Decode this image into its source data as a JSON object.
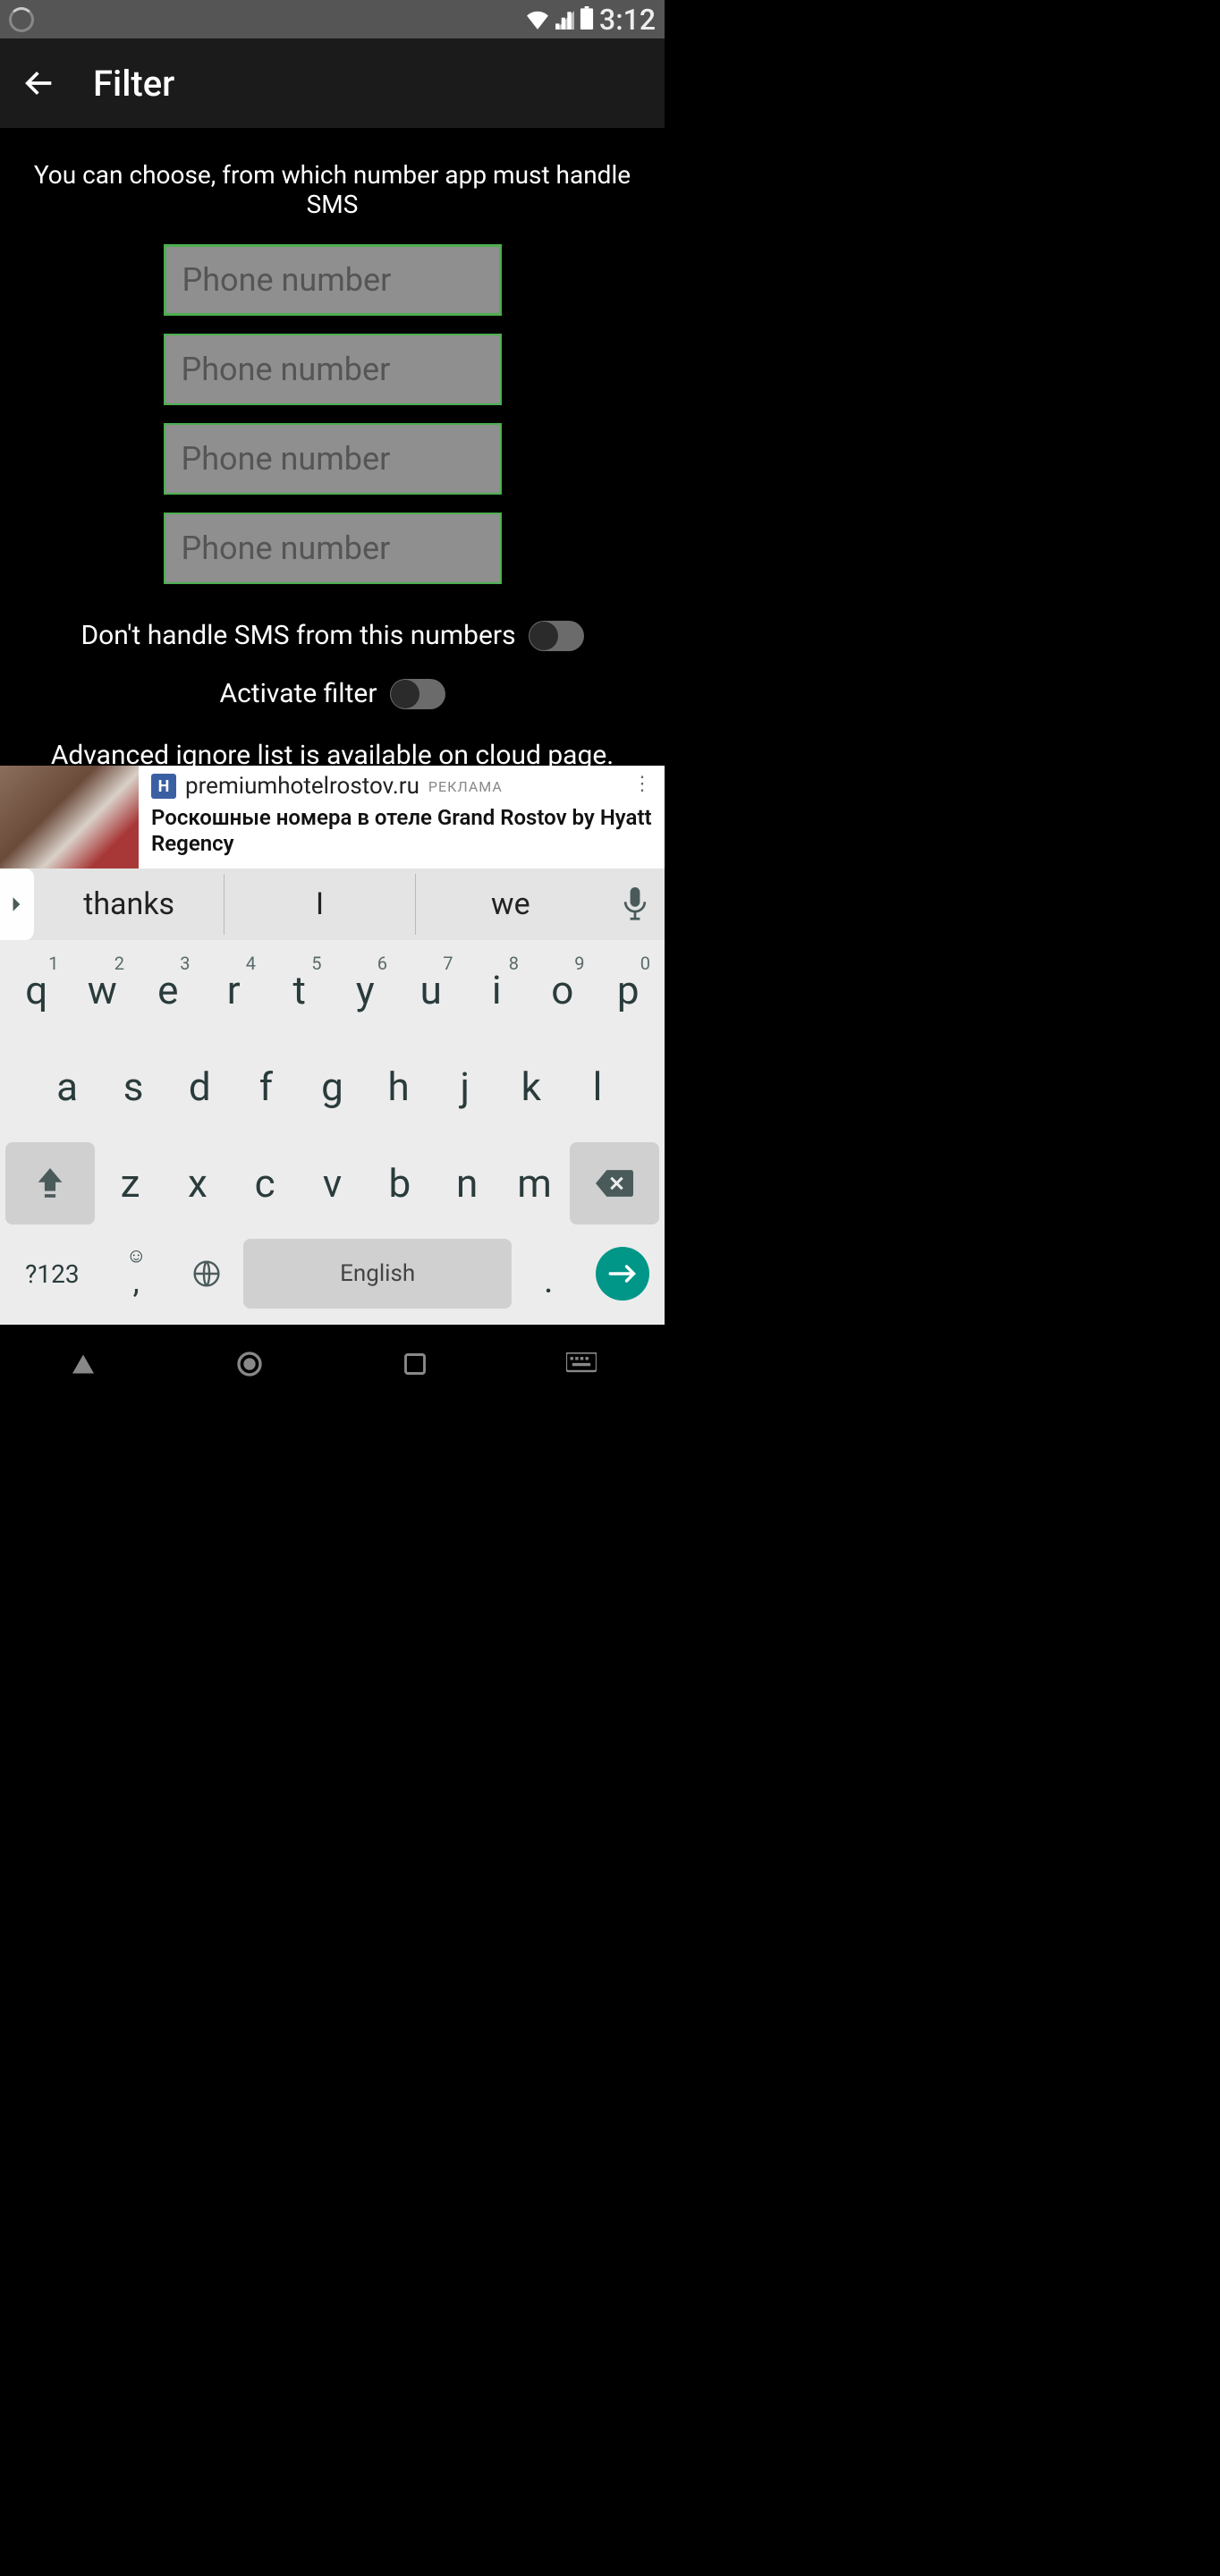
{
  "status": {
    "time": "3:12"
  },
  "header": {
    "title": "Filter"
  },
  "main": {
    "intro": "You can choose, from which number app must handle SMS",
    "placeholder": "Phone number",
    "toggle1_label": "Don't handle SMS from this numbers",
    "toggle2_label": "Activate filter",
    "toggle1_on": false,
    "toggle2_on": false,
    "advanced": "Advanced ignore list is available on cloud page."
  },
  "ad": {
    "logo_letter": "H",
    "domain": "premiumhotelrostov.ru",
    "label": "РЕКЛАМА",
    "text": "Роскошные номера в отеле Grand Rostov by Hyatt Regency"
  },
  "suggestions": {
    "s1": "thanks",
    "s2": "I",
    "s3": "we"
  },
  "keyboard": {
    "row1": [
      {
        "k": "q",
        "n": "1"
      },
      {
        "k": "w",
        "n": "2"
      },
      {
        "k": "e",
        "n": "3"
      },
      {
        "k": "r",
        "n": "4"
      },
      {
        "k": "t",
        "n": "5"
      },
      {
        "k": "y",
        "n": "6"
      },
      {
        "k": "u",
        "n": "7"
      },
      {
        "k": "i",
        "n": "8"
      },
      {
        "k": "o",
        "n": "9"
      },
      {
        "k": "p",
        "n": "0"
      }
    ],
    "row2": [
      "a",
      "s",
      "d",
      "f",
      "g",
      "h",
      "j",
      "k",
      "l"
    ],
    "row3": [
      "z",
      "x",
      "c",
      "v",
      "b",
      "n",
      "m"
    ],
    "symbols": "?123",
    "comma": ",",
    "period": ".",
    "space": "English"
  }
}
